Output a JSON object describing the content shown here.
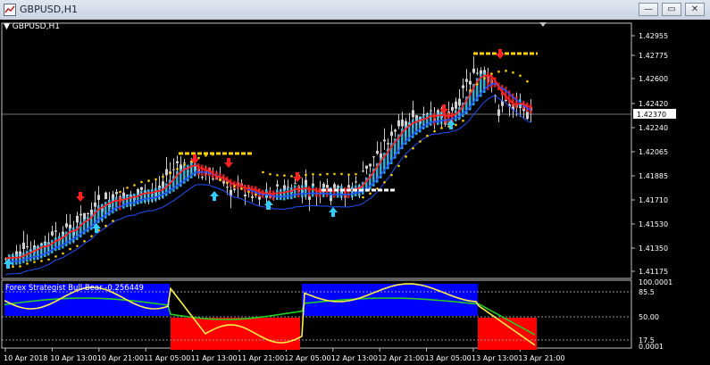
{
  "window": {
    "title": "GBPUSD,H1",
    "controls": {
      "minimize": "—",
      "maximize": "▭",
      "close": "✕"
    }
  },
  "chart": {
    "symbol_label": "GBPUSD,H1",
    "current_price": "1.42370",
    "price_ticks": [
      "1.42955",
      "1.42775",
      "1.42600",
      "1.42420",
      "1.42240",
      "1.42065",
      "1.41885",
      "1.41710",
      "1.41530",
      "1.41350",
      "1.41175"
    ],
    "time_ticks": [
      "10 Apr 2018",
      "10 Apr 13:00",
      "10 Apr 21:00",
      "11 Apr 05:00",
      "11 Apr 13:00",
      "11 Apr 21:00",
      "12 Apr 05:00",
      "12 Apr 13:00",
      "12 Apr 21:00",
      "13 Apr 05:00",
      "13 Apr 13:00",
      "13 Apr 21:00"
    ],
    "indicator": {
      "label": "Forex Strategist Bull-Bear -0.256449",
      "levels": [
        "100.0001",
        "85.5",
        "50.00",
        "17.5",
        "0.0001"
      ]
    },
    "colors": {
      "background": "#000000",
      "bull_bar": "#33ccff",
      "ma_red": "#ff2020",
      "ma_blue": "#2050ff",
      "dots_yellow": "#ffd000",
      "bull_zone": "#0000ff",
      "bear_zone": "#ff0000",
      "line_green": "#22cc22",
      "line_yellow": "#ffee44"
    }
  }
}
